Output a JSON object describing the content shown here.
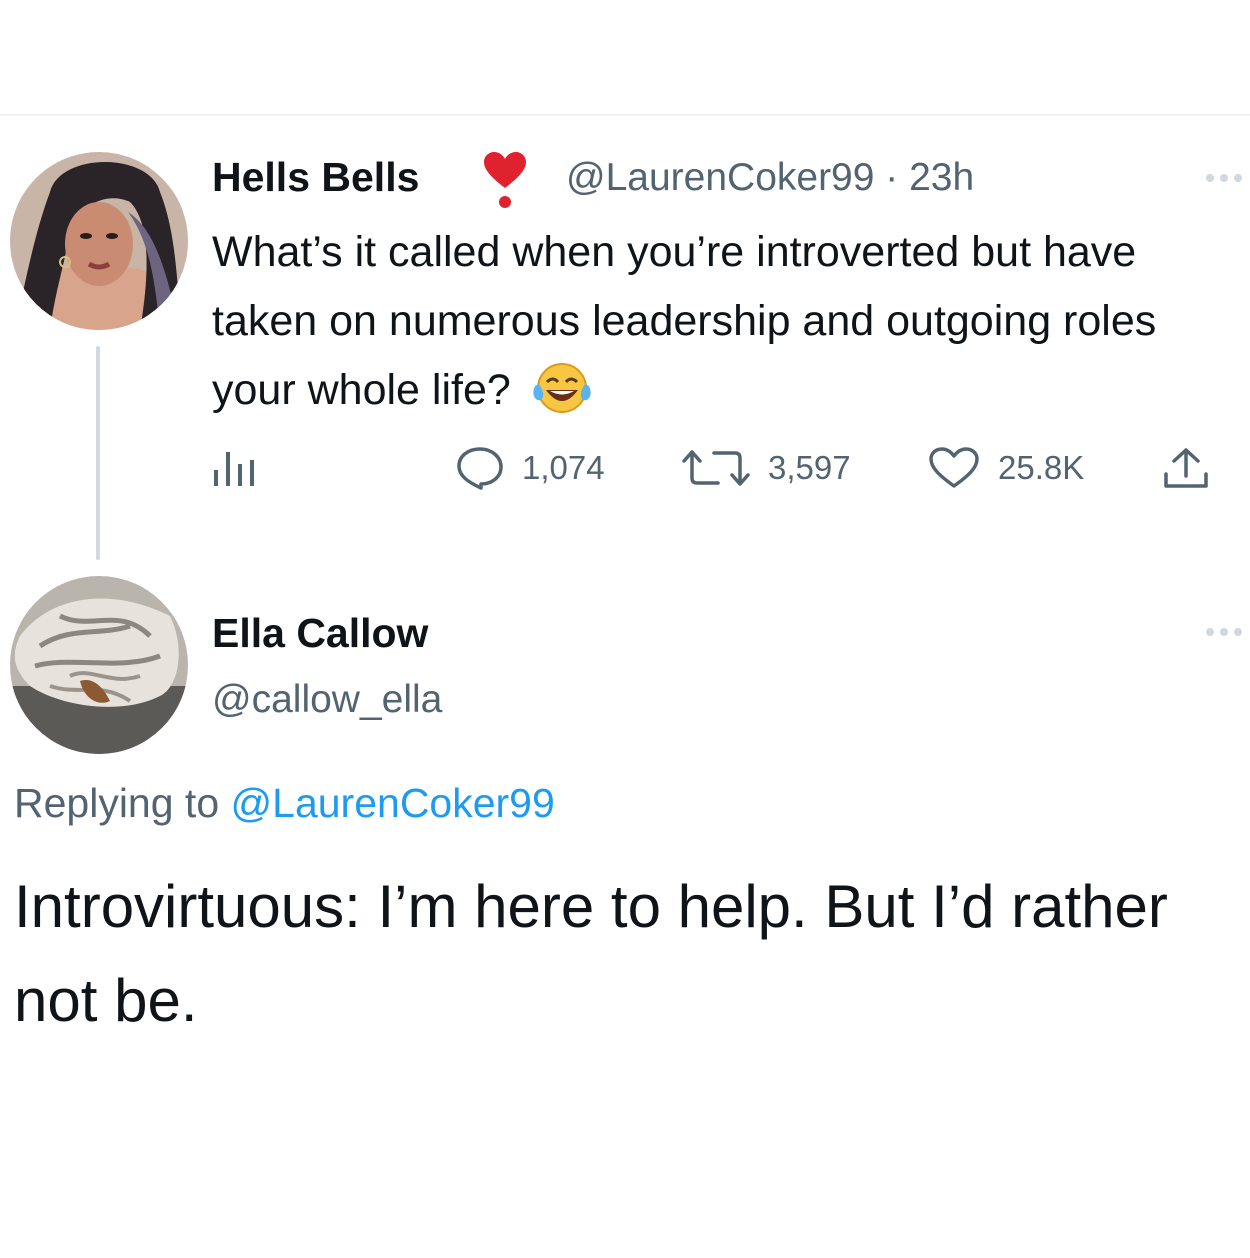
{
  "tweet": {
    "display_name": "Hells Bells",
    "badge_icon": "red-heart-exclamation-icon",
    "handle_time": "@LaurenCoker99 · 23h",
    "text": "What’s it called when you’re introverted but have taken on numerous leadership and outgoing roles your whole life?",
    "emoji": "face-with-tears-of-joy-icon",
    "actions": {
      "analytics_icon": "analytics-icon",
      "reply_count": "1,074",
      "retweet_count": "3,597",
      "like_count": "25.8K",
      "share_icon": "share-icon"
    }
  },
  "reply": {
    "display_name": "Ella Callow",
    "handle": "@callow_ella",
    "replying_prefix": "Replying to",
    "replying_mention": "@LaurenCoker99",
    "text": "Introvirtuous: I’m here to help. But I’d rather not be."
  },
  "colors": {
    "text_primary": "#0f1419",
    "text_secondary": "#536471",
    "accent": "#1d9bf0",
    "divider": "#eff3f4"
  }
}
